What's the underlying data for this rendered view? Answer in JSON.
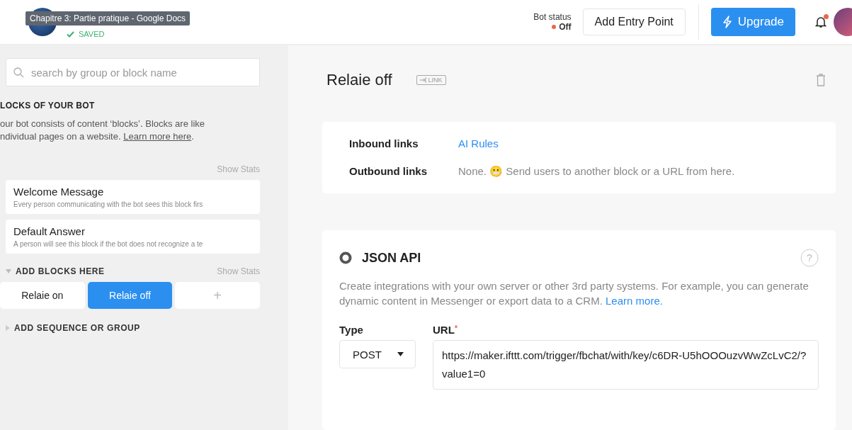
{
  "header": {
    "saved": "SAVED",
    "tooltip": "Chapitre 3: Partie pratique - Google Docs",
    "bot_status": {
      "label": "Bot status",
      "value": "Off",
      "on": false
    },
    "add_entry_point": "Add Entry Point",
    "upgrade": "Upgrade",
    "notification": true
  },
  "sidebar": {
    "search": {
      "placeholder": "search by group or block name"
    },
    "section_title": "LOCKS OF YOUR BOT",
    "intro_lines": [
      "our bot consists of content ‘blocks’. Blocks are like",
      "ndividual pages on a website. "
    ],
    "intro_link": "Learn more here",
    "intro_end": ".",
    "show_stats": "Show Stats",
    "blocks": [
      {
        "title": "Welcome Message",
        "description": "Every person communicating with the bot sees this block firs"
      },
      {
        "title": "Default Answer",
        "description": "A person will see this block if the bot does not recognize a te"
      }
    ],
    "group": {
      "title": "ADD BLOCKS HERE",
      "expanded": true,
      "show_stats": "Show Stats",
      "items": [
        {
          "label": "Relaie on",
          "selected": false
        },
        {
          "label": "Relaie off",
          "selected": true
        }
      ],
      "add": "+"
    },
    "add_sequence": "ADD SEQUENCE OR GROUP"
  },
  "main": {
    "title": "Relaie off",
    "link_badge": "LINK",
    "links": [
      {
        "label": "Inbound links",
        "value": "AI Rules",
        "kind": "link"
      },
      {
        "label": "Outbound links",
        "value": "None. 😬 Send users to another block or a URL from here.",
        "kind": "text"
      }
    ],
    "plugin": {
      "title": "JSON API",
      "description": "Create integrations with your own server or other 3rd party systems. For example, you can generate dynamic content in Messenger or export data to a CRM.",
      "learn_more": "Learn more.",
      "help": "?",
      "type_label": "Type",
      "type_value": "POST",
      "url_label": "URL",
      "url_required": "*",
      "url_value": "https://maker.ifttt.com/trigger/fbchat/with/key/c6DR-U5hOOOuzvWwZcLvC2/?value1=0"
    }
  }
}
